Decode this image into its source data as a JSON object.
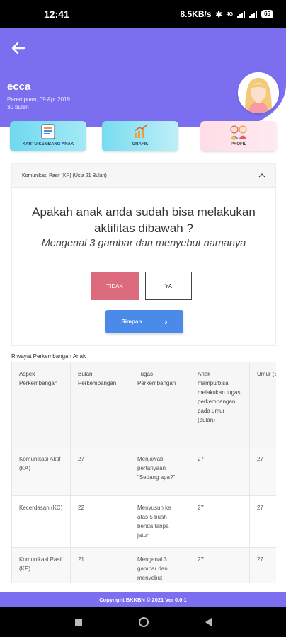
{
  "status_bar": {
    "time": "12:41",
    "speed": "8.5KB/s",
    "network": "4G",
    "battery": "65"
  },
  "header": {
    "child_name": "ecca",
    "gender_dob": "Perempuan, 09 Apr 2019",
    "age": "30 bulan"
  },
  "tiles": [
    {
      "label": "KARTU KEMBANG ANAK"
    },
    {
      "label": "GRAFIK"
    },
    {
      "label": "PROFIL"
    }
  ],
  "question_card": {
    "header": "Komunikasi Pasif (KP) (Usia 21 Bulan)",
    "question": "Apakah anak anda sudah bisa melakukan aktifitas dibawah ?",
    "activity": "Mengenal 3 gambar dan menyebut namanya",
    "btn_no": "TIDAK",
    "btn_yes": "YA",
    "btn_save": "Simpan",
    "save_chevron": "›"
  },
  "history": {
    "title": "Riwayat Perkembangan Anak",
    "columns": [
      "Aspek Perkembangan",
      "Bulan Perkembangan",
      "Tugas Perkembangan",
      "Anak mampu/bisa melakukan tugas perkembangan pada umur (bulan)",
      "Umur (Bulan)"
    ],
    "rows": [
      [
        "Komunikasi Aktif (KA)",
        "27",
        "Menjawab pertanyaan \"Sedang apa?\"",
        "27",
        "27"
      ],
      [
        "Kecerdasan (KC)",
        "22",
        "Menyusun ke atas 5 buah benda tanpa jatuh",
        "27",
        "27"
      ],
      [
        "Komunikasi Pasif (KP)",
        "21",
        "Mengenal 3 gambar dan menyebut",
        "27",
        "27"
      ]
    ]
  },
  "footer": {
    "copyright": "Copyright BKKBN © 2021 Ver 0.0.1"
  },
  "colors": {
    "primary": "#7b6ff0",
    "danger": "#dc6c7d",
    "action": "#4a8bea"
  }
}
